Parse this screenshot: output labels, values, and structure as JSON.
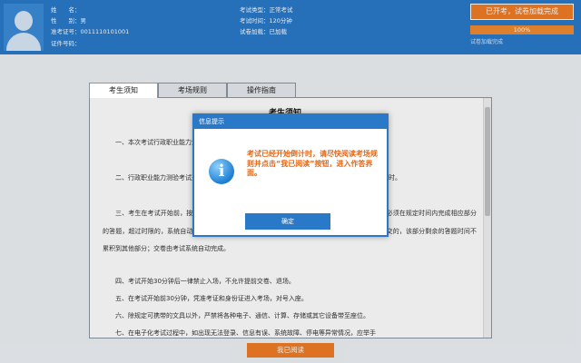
{
  "header": {
    "candidate": {
      "name_label": "姓　　名：",
      "name_value": "",
      "gender_label": "性　　别：",
      "gender_value": "男",
      "ticket_label": "准考证号：",
      "ticket_value": "0011110101001",
      "id_label": "证件号码：",
      "id_value": ""
    },
    "exam": {
      "type_label": "考试类型：",
      "type_value": "正常考试",
      "duration_label": "考试时间：",
      "duration_value": "120分钟",
      "load_label": "试卷加载：",
      "load_value": "已加载"
    },
    "status_button": "已开考，试卷加载完成",
    "progress": {
      "value": 100,
      "text": "100%",
      "caption": "试卷加载完成"
    }
  },
  "tabs": [
    {
      "label": "考生须知",
      "active": true
    },
    {
      "label": "考场规则",
      "active": false
    },
    {
      "label": "操作指南",
      "active": false
    }
  ],
  "document": {
    "title": "考生须知",
    "paragraphs": [
      "一、本次考试行政职业能力测验、申论和公安专业科目实行纸笔化考试。",
      "二、行政职业能力测验考试开始后，考试界面提供两个计时：总考试时间计时和各部分考试时间计时。",
      "三、考生在考试开始前，按照规定时间开始计时。行政职业能力测验由若干部分试题构成，考生必须在规定时间内完成相应部分的答题，超过时限的，系统自动提交该部分答卷，其余部分自动开始计时；考生在指定时限内自行提交的，该部分剩余的答题时间不累积到其他部分；交卷由考试系统自动完成。",
      "四、考试开始30分钟后一律禁止入场，不允许提前交卷、退场。",
      "五、在考试开始前30分钟，凭准考证和身份证进入考场，对号入座。",
      "六、除规定可携带的文具以外，严禁将各种电子、通信、计算、存储或其它设备带至座位。",
      "七、在电子化考试过程中，如出现无法登录、信息有误、系统故障、停电等异常情况，应举手"
    ]
  },
  "dialog": {
    "title": "信息提示",
    "message": "考试已经开始倒计时，请尽快阅读考场规则并点击“我已阅读”按钮，进入作答界面。",
    "ok_label": "确定"
  },
  "read_button": "我已阅读",
  "colors": {
    "header_blue": "#2a79c9",
    "accent_orange": "#ef7c25",
    "dialog_text": "#e8650f"
  },
  "icons": {
    "dialog_icon": "info-icon"
  }
}
